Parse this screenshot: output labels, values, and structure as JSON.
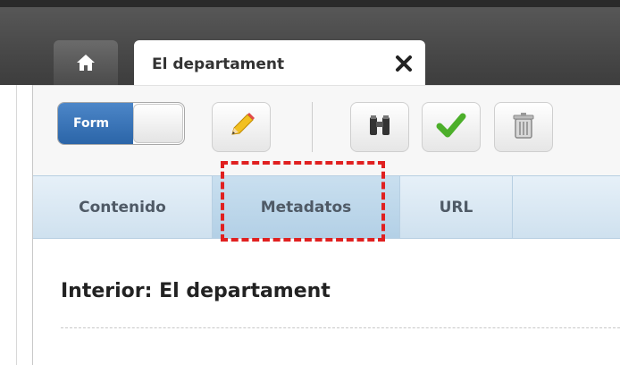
{
  "tabbar": {
    "home_icon": "home-icon",
    "active_tab": {
      "title": "El departament",
      "close_icon": "close-icon"
    }
  },
  "toolbar": {
    "form_toggle_label": "Form",
    "buttons": [
      {
        "name": "edit",
        "icon": "pencil-icon"
      },
      {
        "name": "search",
        "icon": "binoculars-icon"
      },
      {
        "name": "approve",
        "icon": "checkmark-icon"
      },
      {
        "name": "delete",
        "icon": "trash-icon"
      }
    ]
  },
  "subtabs": {
    "items": [
      {
        "label": "Contenido"
      },
      {
        "label": "Metadatos"
      },
      {
        "label": "URL"
      }
    ],
    "active_index": 1
  },
  "content": {
    "title": "Interior: El departament"
  },
  "colors": {
    "accent": "#2b65a8",
    "highlight": "#e02020"
  }
}
